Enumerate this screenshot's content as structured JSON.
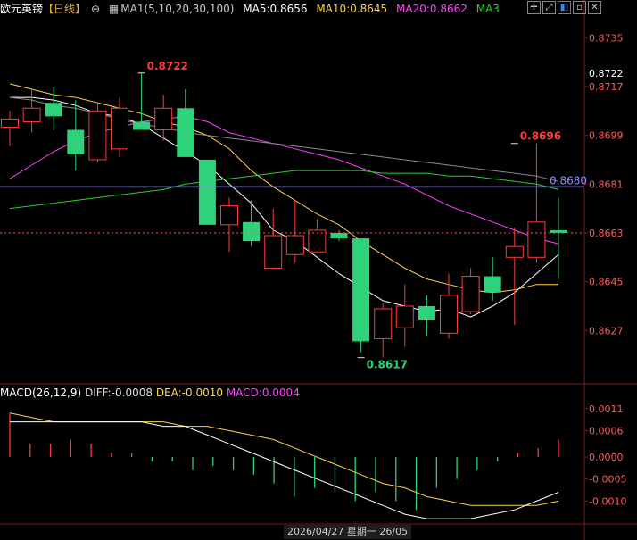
{
  "header": {
    "symbol": "欧元英镑",
    "period": "【日线】",
    "period_toggle": "⊖",
    "ma_label": "MA1(5,10,20,30,100)",
    "ma5": "MA5:0.8656",
    "ma10": "MA10:0.8645",
    "ma20": "MA20:0.8662",
    "ma3": "MA3"
  },
  "macd_header": {
    "name": "MACD(26,12,9)",
    "diff": "DIFF:-0.0008",
    "dea": "DEA:-0.0010",
    "macd": "MACD:0.0004"
  },
  "colors": {
    "up": "#ff3b3b",
    "down": "#2ed27a",
    "ma5": "#ffffff",
    "ma10": "#ffd24a",
    "ma20": "#ff40ff",
    "ma30": "#2bd02b",
    "ma100": "#8a8a8a",
    "hline": "#8c8cff",
    "price_dashed": "#ff5a5a"
  },
  "toolbar": {
    "icons": [
      "crosshair-icon",
      "expand-icon",
      "layout-icon",
      "minimize-icon",
      "close-icon"
    ]
  },
  "date_label": "2026/04/27 星期一 26/05",
  "chart_data": [
    {
      "type": "candlestick",
      "y_ticks": [
        0.8735,
        0.8717,
        0.8699,
        0.8681,
        0.8663,
        0.8645,
        0.8627
      ],
      "ylim": [
        0.8608,
        0.8743
      ],
      "highlight_labels": {
        "price_tag": 0.8722,
        "hline_value": 0.868,
        "current": 0.8663
      },
      "annotations": [
        {
          "text": "0.8722",
          "index": 6,
          "value": 0.8722,
          "color": "up"
        },
        {
          "text": "0.8696",
          "index": 23,
          "value": 0.8696,
          "color": "up"
        },
        {
          "text": "0.8617",
          "index": 16,
          "value": 0.8617,
          "color": "down"
        }
      ],
      "candles": [
        {
          "o": 0.8702,
          "h": 0.8708,
          "l": 0.8695,
          "c": 0.8705
        },
        {
          "o": 0.8704,
          "h": 0.8716,
          "l": 0.87,
          "c": 0.8709
        },
        {
          "o": 0.8711,
          "h": 0.8717,
          "l": 0.8701,
          "c": 0.8706
        },
        {
          "o": 0.8701,
          "h": 0.8712,
          "l": 0.8686,
          "c": 0.8692
        },
        {
          "o": 0.869,
          "h": 0.8711,
          "l": 0.8689,
          "c": 0.8708
        },
        {
          "o": 0.8694,
          "h": 0.8713,
          "l": 0.8691,
          "c": 0.8709
        },
        {
          "o": 0.8704,
          "h": 0.8722,
          "l": 0.8702,
          "c": 0.8701
        },
        {
          "o": 0.8701,
          "h": 0.8714,
          "l": 0.8697,
          "c": 0.8709
        },
        {
          "o": 0.8709,
          "h": 0.8716,
          "l": 0.8691,
          "c": 0.8691
        },
        {
          "o": 0.869,
          "h": 0.869,
          "l": 0.8666,
          "c": 0.8666
        },
        {
          "o": 0.8666,
          "h": 0.8676,
          "l": 0.8656,
          "c": 0.8673
        },
        {
          "o": 0.8667,
          "h": 0.8675,
          "l": 0.8658,
          "c": 0.866
        },
        {
          "o": 0.865,
          "h": 0.8672,
          "l": 0.865,
          "c": 0.8662
        },
        {
          "o": 0.8655,
          "h": 0.8675,
          "l": 0.8652,
          "c": 0.8662
        },
        {
          "o": 0.8656,
          "h": 0.8668,
          "l": 0.8656,
          "c": 0.8664
        },
        {
          "o": 0.8663,
          "h": 0.8664,
          "l": 0.866,
          "c": 0.8661
        },
        {
          "o": 0.8661,
          "h": 0.8661,
          "l": 0.8619,
          "c": 0.8623
        },
        {
          "o": 0.8624,
          "h": 0.8637,
          "l": 0.8617,
          "c": 0.8635
        },
        {
          "o": 0.8628,
          "h": 0.8644,
          "l": 0.8621,
          "c": 0.8636
        },
        {
          "o": 0.8636,
          "h": 0.864,
          "l": 0.8625,
          "c": 0.8631
        },
        {
          "o": 0.8626,
          "h": 0.8648,
          "l": 0.8624,
          "c": 0.864
        },
        {
          "o": 0.8634,
          "h": 0.865,
          "l": 0.8633,
          "c": 0.8647
        },
        {
          "o": 0.8647,
          "h": 0.8654,
          "l": 0.8638,
          "c": 0.8641
        },
        {
          "o": 0.8654,
          "h": 0.8665,
          "l": 0.8629,
          "c": 0.8658
        },
        {
          "o": 0.8654,
          "h": 0.8696,
          "l": 0.8652,
          "c": 0.8667
        },
        {
          "o": 0.8664,
          "h": 0.8676,
          "l": 0.8646,
          "c": 0.8663
        }
      ],
      "ma_series": [
        {
          "name": "MA5",
          "color": "ma5",
          "values": [
            0.8713,
            0.8713,
            0.8712,
            0.871,
            0.8707,
            0.8706,
            0.8703,
            0.8698,
            0.8693,
            0.8688,
            0.8681,
            0.8674,
            0.8664,
            0.866,
            0.8654,
            0.8648,
            0.8643,
            0.8638,
            0.8636,
            0.8634,
            0.8635,
            0.8632,
            0.8636,
            0.8641,
            0.8648,
            0.8655
          ]
        },
        {
          "name": "MA10",
          "color": "ma10",
          "values": [
            0.8718,
            0.8716,
            0.8714,
            0.8713,
            0.8711,
            0.8709,
            0.8707,
            0.8704,
            0.8702,
            0.8699,
            0.8694,
            0.8686,
            0.868,
            0.8675,
            0.867,
            0.8666,
            0.866,
            0.8655,
            0.865,
            0.8646,
            0.8644,
            0.8642,
            0.8641,
            0.8642,
            0.8644,
            0.8644
          ]
        },
        {
          "name": "MA20",
          "color": "ma20",
          "values": [
            0.8683,
            0.8688,
            0.8693,
            0.8697,
            0.87,
            0.8702,
            0.8704,
            0.8705,
            0.8706,
            0.8704,
            0.87,
            0.8698,
            0.8696,
            0.8694,
            0.8692,
            0.869,
            0.8687,
            0.8684,
            0.8681,
            0.8677,
            0.8673,
            0.867,
            0.8667,
            0.8664,
            0.8661,
            0.8659
          ]
        },
        {
          "name": "MA30",
          "color": "ma30",
          "values": [
            0.8672,
            0.8673,
            0.8674,
            0.8675,
            0.8676,
            0.8677,
            0.8678,
            0.8679,
            0.8681,
            0.8682,
            0.8683,
            0.8684,
            0.8685,
            0.8686,
            0.8686,
            0.8686,
            0.8686,
            0.8685,
            0.8685,
            0.8685,
            0.8684,
            0.8684,
            0.8683,
            0.8682,
            0.8681,
            0.8679
          ]
        },
        {
          "name": "MA100",
          "color": "ma100",
          "values": [
            0.8713,
            0.8712,
            0.871,
            0.8709,
            0.8707,
            0.8705,
            0.8703,
            0.8702,
            0.87,
            0.8699,
            0.8698,
            0.8697,
            0.8696,
            0.8695,
            0.8694,
            0.8693,
            0.8692,
            0.8691,
            0.869,
            0.8689,
            0.8688,
            0.8687,
            0.8686,
            0.8685,
            0.8684,
            0.8682
          ]
        }
      ]
    },
    {
      "type": "macd",
      "y_ticks": [
        0.0011,
        0.0006,
        0.0,
        -0.0005,
        -0.001
      ],
      "ylim": [
        -0.0015,
        0.0013
      ],
      "diff": [
        0.0008,
        0.0008,
        0.0008,
        0.0008,
        0.0008,
        0.0008,
        0.0008,
        0.0007,
        0.0007,
        0.0005,
        0.0003,
        0.0001,
        -0.0001,
        -0.0003,
        -0.0005,
        -0.0007,
        -0.0009,
        -0.0011,
        -0.0013,
        -0.0014,
        -0.0014,
        -0.0014,
        -0.0013,
        -0.0012,
        -0.001,
        -0.0008
      ],
      "dea": [
        0.001,
        0.0009,
        0.0008,
        0.0008,
        0.0008,
        0.0008,
        0.0008,
        0.0008,
        0.0007,
        0.0007,
        0.0006,
        0.0005,
        0.0004,
        0.0002,
        0.0,
        -0.0002,
        -0.0004,
        -0.0006,
        -0.0007,
        -0.0009,
        -0.001,
        -0.0011,
        -0.0011,
        -0.0011,
        -0.0011,
        -0.001
      ],
      "macd": [
        0.001,
        0.0003,
        0.0003,
        0.0004,
        0.0003,
        0.0001,
        0.0001,
        -0.0001,
        -0.0001,
        -0.0003,
        -0.0002,
        -0.0003,
        -0.0004,
        -0.0006,
        -0.0009,
        -0.0007,
        -0.0008,
        -0.001,
        -0.0008,
        -0.001,
        -0.0012,
        -0.0007,
        -0.0005,
        -0.0003,
        -0.0001,
        0.0001,
        0.0002,
        0.0004
      ]
    }
  ]
}
